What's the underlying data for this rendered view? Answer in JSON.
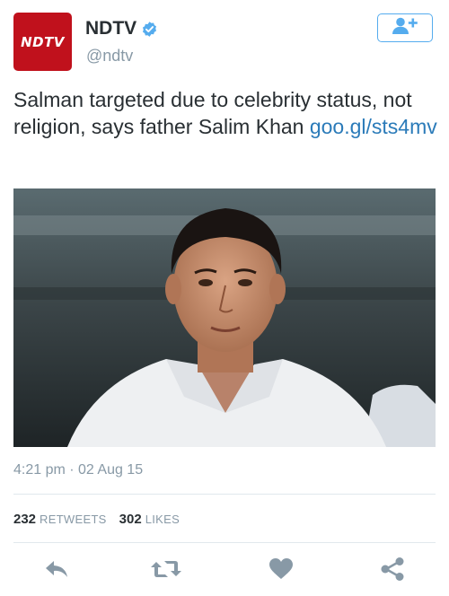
{
  "account": {
    "avatar_text": "NDTV",
    "display_name": "NDTV",
    "handle": "@ndtv",
    "verified": true
  },
  "tweet": {
    "text": "Salman targeted due to celebrity status, not religion, says father Salim Khan ",
    "link_text": "goo.gl/sts4mv",
    "timestamp": "4:21 pm · 02 Aug 15"
  },
  "stats": {
    "retweets_count": "232",
    "retweets_label": "RETWEETS",
    "likes_count": "302",
    "likes_label": "LIKES"
  },
  "icons": {
    "follow": "add-user-icon",
    "verified": "verified-badge-icon",
    "reply": "reply-icon",
    "retweet": "retweet-icon",
    "like": "heart-icon",
    "share": "share-icon"
  },
  "colors": {
    "brand_red": "#c0111c",
    "twitter_blue": "#55acee",
    "link_blue": "#2b7bb9",
    "muted_text": "#8899a6",
    "action_gray": "#8899a6"
  }
}
